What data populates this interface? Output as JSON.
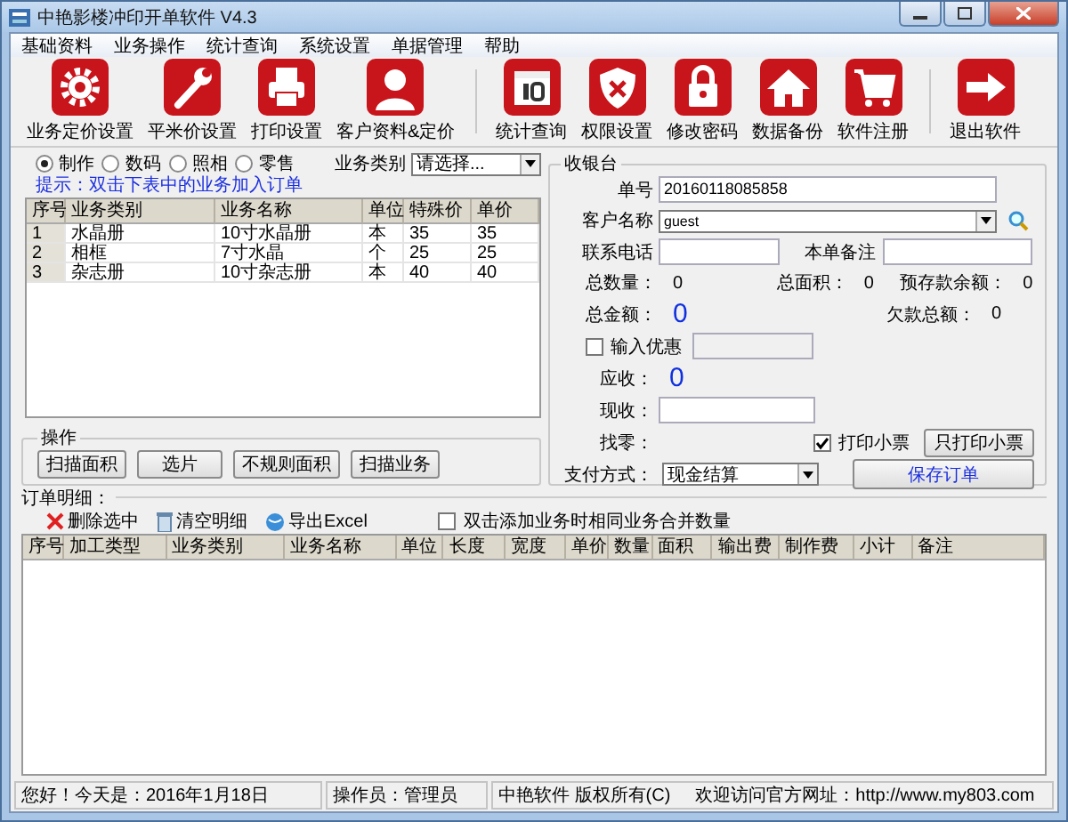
{
  "window": {
    "title": "中艳影楼冲印开单软件 V4.3"
  },
  "menu": [
    "基础资料",
    "业务操作",
    "统计查询",
    "系统设置",
    "单据管理",
    "帮助"
  ],
  "toolbar": [
    [
      {
        "label": "业务定价设置",
        "kind": "gear"
      },
      {
        "label": "平米价设置",
        "kind": "wrench"
      },
      {
        "label": "打印设置",
        "kind": "printer"
      },
      {
        "label": "客户资料&定价",
        "kind": "person"
      }
    ],
    [
      {
        "label": "统计查询",
        "kind": "calendar"
      },
      {
        "label": "权限设置",
        "kind": "shield"
      },
      {
        "label": "修改密码",
        "kind": "lock"
      },
      {
        "label": "数据备份",
        "kind": "house"
      },
      {
        "label": "软件注册",
        "kind": "cart"
      }
    ],
    [
      {
        "label": "退出软件",
        "kind": "exit"
      }
    ]
  ],
  "categories": [
    {
      "label": "制作",
      "selected": true
    },
    {
      "label": "数码",
      "selected": false
    },
    {
      "label": "照相",
      "selected": false
    },
    {
      "label": "零售",
      "selected": false
    }
  ],
  "business_type": {
    "label": "业务类别",
    "value": "请选择..."
  },
  "hint": "提示：双击下表中的业务加入订单",
  "products": {
    "columns": [
      "序号",
      "业务类别",
      "业务名称",
      "单位",
      "特殊价",
      "单价"
    ],
    "rows": [
      [
        "1",
        "水晶册",
        "10寸水晶册",
        "本",
        "35",
        "35"
      ],
      [
        "2",
        "相框",
        "7寸水晶",
        "个",
        "25",
        "25"
      ],
      [
        "3",
        "杂志册",
        "10寸杂志册",
        "本",
        "40",
        "40"
      ]
    ]
  },
  "operations": {
    "title": "操作",
    "buttons": [
      "扫描面积",
      "选片",
      "不规则面积",
      "扫描业务"
    ]
  },
  "cashier": {
    "title": "收银台",
    "order_no": {
      "label": "单号",
      "value": "20160118085858"
    },
    "customer": {
      "label": "客户名称",
      "value": "guest"
    },
    "phone": {
      "label": "联系电话"
    },
    "remark": {
      "label": "本单备注"
    },
    "total_qty": {
      "label": "总数量：",
      "value": "0"
    },
    "total_area": {
      "label": "总面积：",
      "value": "0"
    },
    "prepaid_balance": {
      "label": "预存款余额：",
      "value": "0"
    },
    "total_amount": {
      "label": "总金额：",
      "value": "0"
    },
    "debt_total": {
      "label": "欠款总额：",
      "value": "0"
    },
    "discount": {
      "label": "输入优惠",
      "checked": false
    },
    "receivable": {
      "label": "应收：",
      "value": "0"
    },
    "received": {
      "label": "现收："
    },
    "change": {
      "label": "找零："
    },
    "print_receipt": {
      "label": "打印小票",
      "checked": true
    },
    "print_only": "只打印小票",
    "payment": {
      "label": "支付方式：",
      "value": "现金结算"
    },
    "save": "保存订单"
  },
  "order": {
    "title": "订单明细：",
    "actions": [
      {
        "label": "删除选中",
        "kind": "delete"
      },
      {
        "label": "清空明细",
        "kind": "clear"
      },
      {
        "label": "导出Excel",
        "kind": "export"
      }
    ],
    "merge": {
      "label": "双击添加业务时相同业务合并数量",
      "checked": false
    },
    "columns": [
      "序号",
      "加工类型",
      "业务类别",
      "业务名称",
      "单位",
      "长度",
      "宽度",
      "单价",
      "数量",
      "面积",
      "输出费",
      "制作费",
      "小计",
      "备注"
    ]
  },
  "status_bar": [
    "您好！今天是：2016年1月18日",
    "操作员：管理员",
    "中艳软件 版权所有(C)",
    "欢迎访问官方网址：http://www.my803.com"
  ]
}
